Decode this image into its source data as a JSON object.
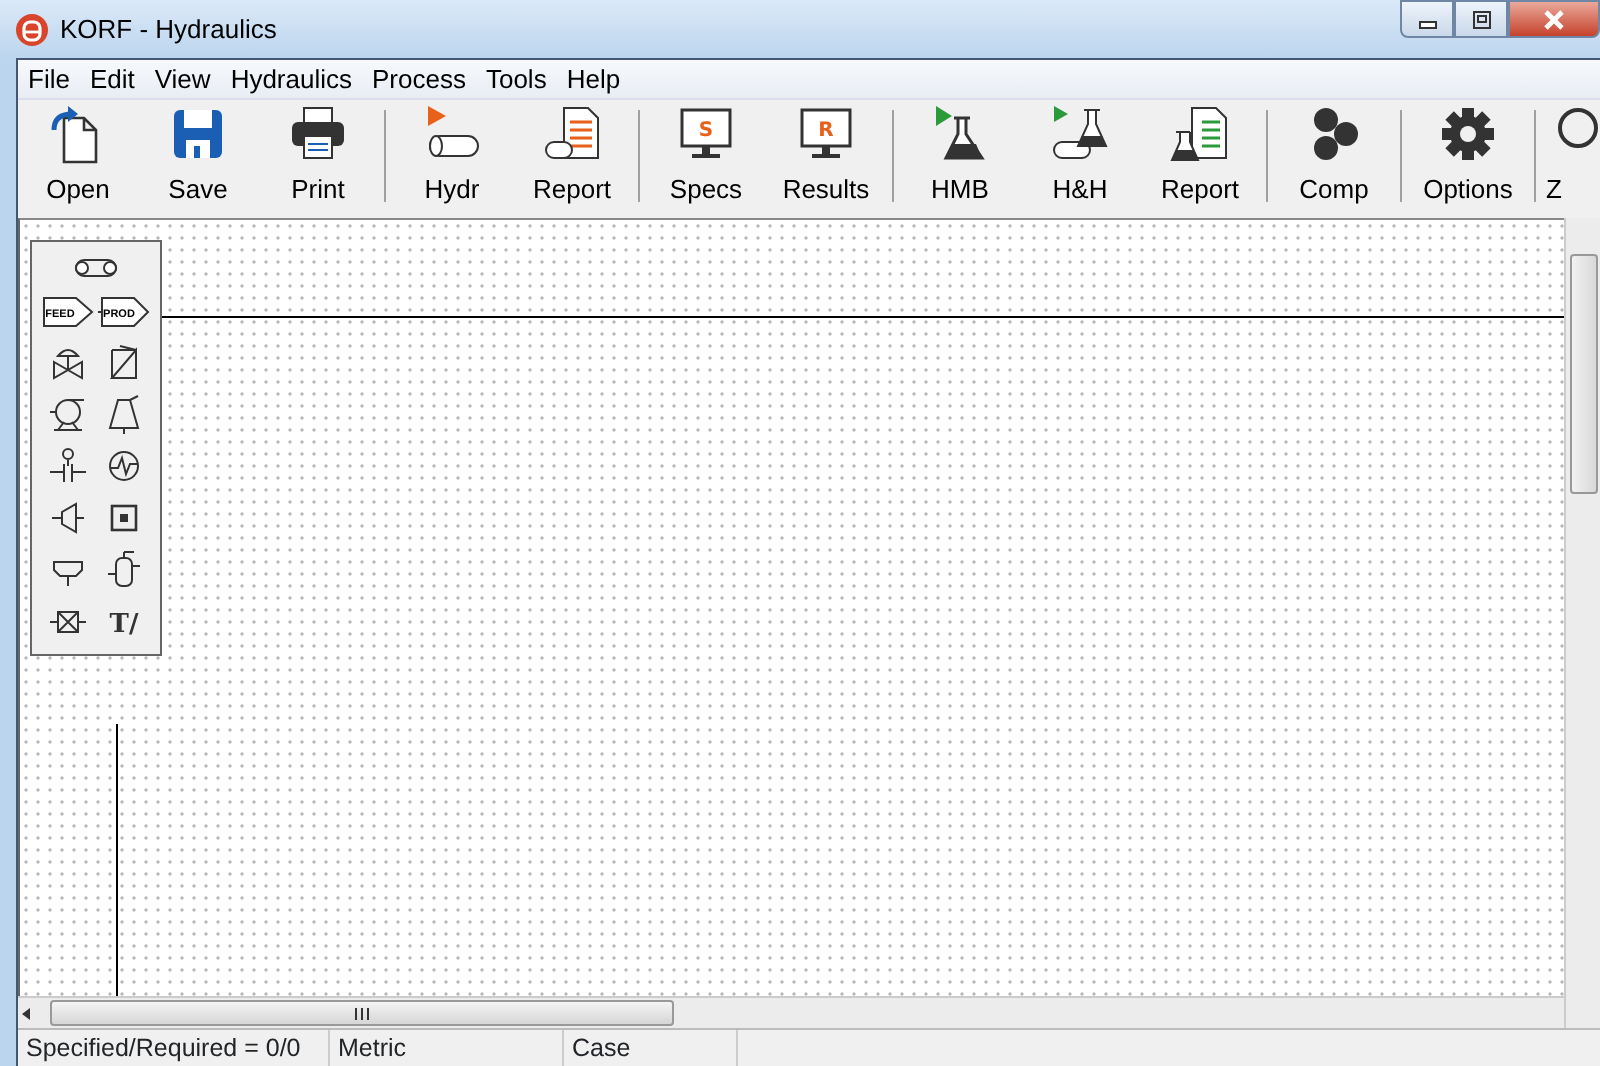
{
  "window": {
    "title": "KORF - Hydraulics"
  },
  "menu": [
    "File",
    "Edit",
    "View",
    "Hydraulics",
    "Process",
    "Tools",
    "Help"
  ],
  "toolbar": [
    {
      "kind": "button",
      "label": "Open"
    },
    {
      "kind": "button",
      "label": "Save"
    },
    {
      "kind": "button",
      "label": "Print"
    },
    {
      "kind": "separator"
    },
    {
      "kind": "button",
      "label": "Hydr"
    },
    {
      "kind": "button",
      "label": "Report"
    },
    {
      "kind": "separator"
    },
    {
      "kind": "button",
      "glyph": "S",
      "label": "Specs"
    },
    {
      "kind": "button",
      "glyph": "R",
      "label": "Results"
    },
    {
      "kind": "separator"
    },
    {
      "kind": "button",
      "label": "HMB"
    },
    {
      "kind": "button",
      "label": "H&H"
    },
    {
      "kind": "button",
      "label": "Report"
    },
    {
      "kind": "separator"
    },
    {
      "kind": "button",
      "label": "Comp"
    },
    {
      "kind": "separator"
    },
    {
      "kind": "button",
      "label": "Options"
    },
    {
      "kind": "separator"
    },
    {
      "kind": "button",
      "label": "Z"
    }
  ],
  "palette": [
    [
      {
        "kind": "pipe"
      }
    ],
    [
      {
        "kind": "feed",
        "label": "FEED"
      },
      {
        "kind": "product",
        "label": "PROD"
      }
    ],
    [
      {
        "kind": "valve"
      },
      {
        "kind": "check"
      }
    ],
    [
      {
        "kind": "pump"
      },
      {
        "kind": "compressor"
      }
    ],
    [
      {
        "kind": "orifice"
      },
      {
        "kind": "exchanger"
      }
    ],
    [
      {
        "kind": "reducer"
      },
      {
        "kind": "equipment"
      }
    ],
    [
      {
        "kind": "tee"
      },
      {
        "kind": "vessel"
      }
    ],
    [
      {
        "kind": "misc"
      },
      {
        "kind": "text",
        "label": "T/"
      }
    ]
  ],
  "status_bar": [
    "Specified/Required = 0/0",
    "Metric",
    "Case"
  ]
}
